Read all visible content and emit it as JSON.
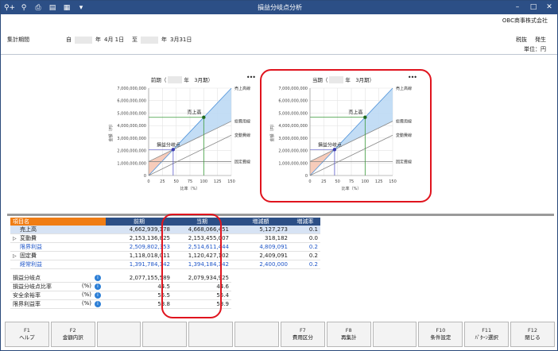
{
  "titlebar": {
    "title": "損益分岐点分析",
    "icons": [
      "search-plus-icon",
      "search-icon",
      "print-icon",
      "print-preview-icon",
      "excel-icon",
      "dropdown-icon"
    ],
    "window_buttons": [
      "minimize-icon",
      "maximize-icon",
      "close-icon"
    ]
  },
  "company": "OBC商事株式会社",
  "period": {
    "label": "集計期間",
    "from_prefix": "自",
    "from_year_suffix": "年",
    "from_date": "4月 1日",
    "to_prefix": "至",
    "to_year_suffix": "年",
    "to_date": "3月31日"
  },
  "tax": {
    "tax_label": "税抜",
    "basis": "発生",
    "unit": "単位：円"
  },
  "charts": [
    {
      "title_prefix": "前期（",
      "title_suffix": "年　3月期）",
      "menu": "•••"
    },
    {
      "title_prefix": "当期（",
      "title_suffix": "年　3月期）",
      "menu": "•••"
    }
  ],
  "chart_data": [
    {
      "type": "line",
      "title": "前期（　　年　3月期）",
      "xlabel": "比率（%）",
      "ylabel": "金額（円）",
      "xlim": [
        0,
        150
      ],
      "ylim": [
        0,
        7000000000
      ],
      "xticks": [
        "0",
        "25",
        "50",
        "75",
        "100",
        "125",
        "150"
      ],
      "yticks": [
        "0",
        "1,000,000,000",
        "2,000,000,000",
        "3,000,000,000",
        "4,000,000,000",
        "5,000,000,000",
        "6,000,000,000",
        "7,000,000,000"
      ],
      "series": [
        {
          "name": "売上高線",
          "x": [
            0,
            150
          ],
          "y": [
            0,
            6994349268
          ]
        },
        {
          "name": "総費用線",
          "x": [
            0,
            150
          ],
          "y": [
            1118018011,
            4347723389
          ]
        },
        {
          "name": "変動費線",
          "x": [
            0,
            150
          ],
          "y": [
            0,
            3229705378
          ]
        },
        {
          "name": "固定費線",
          "x": [
            0,
            150
          ],
          "y": [
            1118018011,
            1118018011
          ]
        }
      ],
      "annotations": [
        {
          "label": "売上高",
          "x": 100,
          "y": 4662939178
        },
        {
          "label": "損益分岐点",
          "x": 44.5,
          "y": 2077155589
        }
      ]
    },
    {
      "type": "line",
      "title": "当期（　　年　3月期）",
      "xlabel": "比率（%）",
      "ylabel": "金額（円）",
      "xlim": [
        0,
        150
      ],
      "ylim": [
        0,
        7000000000
      ],
      "xticks": [
        "0",
        "25",
        "50",
        "75",
        "100",
        "125",
        "150"
      ],
      "yticks": [
        "0",
        "1,000,000,000",
        "2,000,000,000",
        "3,000,000,000",
        "4,000,000,000",
        "5,000,000,000",
        "6,000,000,000",
        "7,000,000,000"
      ],
      "series": [
        {
          "name": "売上高線",
          "x": [
            0,
            150
          ],
          "y": [
            0,
            7002099677
          ]
        },
        {
          "name": "総費用線",
          "x": [
            0,
            150
          ],
          "y": [
            1120427102,
            4350609612
          ]
        },
        {
          "name": "変動費線",
          "x": [
            0,
            150
          ],
          "y": [
            0,
            3230182510
          ]
        },
        {
          "name": "固定費線",
          "x": [
            0,
            150
          ],
          "y": [
            1120427102,
            1120427102
          ]
        }
      ],
      "annotations": [
        {
          "label": "売上高",
          "x": 100,
          "y": 4668066451
        },
        {
          "label": "損益分岐点",
          "x": 44.6,
          "y": 2079934925
        }
      ]
    }
  ],
  "table": {
    "headers": [
      "項目名",
      "前期",
      "当期",
      "増減額",
      "増減率"
    ],
    "rows": [
      {
        "name": "売上高",
        "prev": "4,662,939,178",
        "curr": "4,668,066,451",
        "diff": "5,127,273",
        "rate": "0.1",
        "style": "sel",
        "expand": ""
      },
      {
        "name": "変動費",
        "prev": "2,153,136,825",
        "curr": "2,153,455,007",
        "diff": "318,182",
        "rate": "0.0",
        "style": "",
        "expand": "▷"
      },
      {
        "name": "限界利益",
        "prev": "2,509,802,353",
        "curr": "2,514,611,444",
        "diff": "4,809,091",
        "rate": "0.2",
        "style": "blue",
        "expand": ""
      },
      {
        "name": "固定費",
        "prev": "1,118,018,011",
        "curr": "1,120,427,102",
        "diff": "2,409,091",
        "rate": "0.2",
        "style": "",
        "expand": "▷"
      },
      {
        "name": "経常利益",
        "prev": "1,391,784,342",
        "curr": "1,394,184,342",
        "diff": "2,400,000",
        "rate": "0.2",
        "style": "blue",
        "expand": ""
      }
    ],
    "stats": [
      {
        "name": "損益分岐点",
        "unit": "",
        "prev": "2,077,155,589",
        "curr": "2,079,934,925"
      },
      {
        "name": "損益分岐点比率",
        "unit": "(%)",
        "prev": "44.5",
        "curr": "44.6"
      },
      {
        "name": "安全余裕率",
        "unit": "(%)",
        "prev": "55.5",
        "curr": "55.4"
      },
      {
        "name": "限界利益率",
        "unit": "(%)",
        "prev": "53.8",
        "curr": "53.9"
      }
    ]
  },
  "fkeys": [
    {
      "key": "F1",
      "label": "ヘルプ"
    },
    {
      "key": "F2",
      "label": "金額内訳"
    },
    {
      "key": "",
      "label": ""
    },
    {
      "key": "",
      "label": ""
    },
    {
      "key": "",
      "label": ""
    },
    {
      "key": "",
      "label": ""
    },
    {
      "key": "F7",
      "label": "費用区分"
    },
    {
      "key": "F8",
      "label": "再集計"
    },
    {
      "key": "",
      "label": ""
    },
    {
      "key": "F10",
      "label": "条件設定"
    },
    {
      "key": "F11",
      "label": "ﾊﾟﾀｰﾝ選択"
    },
    {
      "key": "F12",
      "label": "閉じる"
    }
  ],
  "colors": {
    "accent": "#2c4f86",
    "header_orange": "#f07d14",
    "profit_fill": "#bcd9f4",
    "loss_fill": "#f6c7b4",
    "sales_line": "#4a90d9",
    "cost_line": "#888888",
    "target_line": "#3a9a3a",
    "highlight": "#e0141e"
  }
}
